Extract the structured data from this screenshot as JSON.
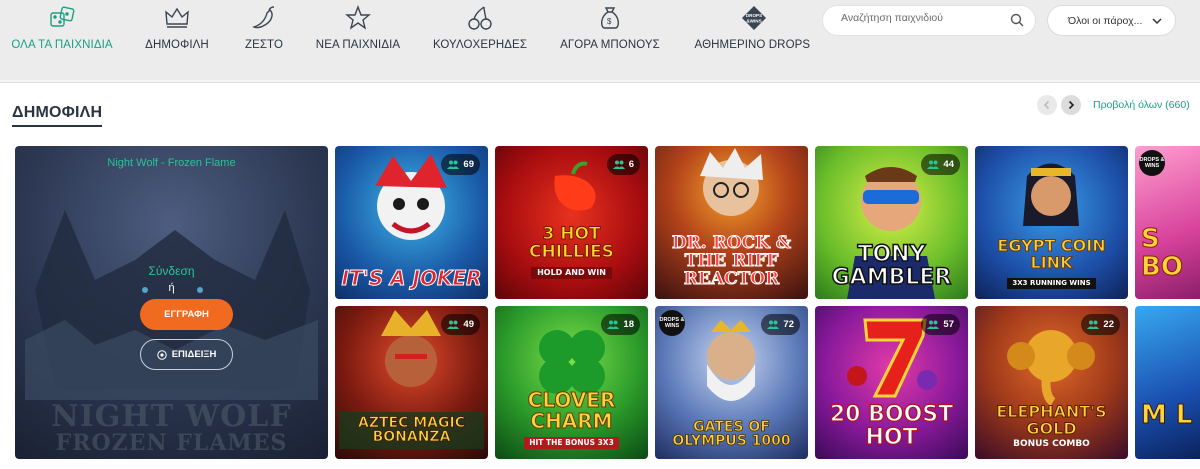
{
  "nav": {
    "items": [
      {
        "label": "ΟΛΑ ΤΑ ΠΑΙΧΝΙΔΙΑ",
        "icon": "dice-icon",
        "active": true
      },
      {
        "label": "ΔΗΜΟΦΙΛΗ",
        "icon": "crown-icon"
      },
      {
        "label": "ΖΕΣΤΟ",
        "icon": "chili-icon"
      },
      {
        "label": "ΝΕΑ ΠΑΙΧΝΙΔΙΑ",
        "icon": "star-icon"
      },
      {
        "label": "ΚΟΥΛΟΧΕΡΗΔΕΣ",
        "icon": "cherries-icon"
      },
      {
        "label": "ΑΓΟΡΑ ΜΠΟΝΟΥΣ",
        "icon": "money-bag-icon"
      },
      {
        "label": "ΚΑΘΗΜΕΡΙΝΟ DROPS &",
        "icon": "drops-wins-icon"
      }
    ],
    "drops_icon_text": "DROPS & WINS"
  },
  "search": {
    "placeholder": "Αναζήτηση παιχνιδιού"
  },
  "provider": {
    "selected": "Όλοι οι πάροχ..."
  },
  "section": {
    "title": "ΔΗΜΟΦΙΛΗ",
    "view_all": "Προβολή όλων (660)"
  },
  "featured": {
    "title": "Night Wolf - Frozen Flame",
    "login": "Σύνδεση",
    "or": "ή",
    "register": "ΕΓΓΡΑΦΗ",
    "demo": "ΕΠΙΔΕΙΞΗ",
    "logo_line1": "NIGHT WOLF",
    "logo_line2": "FROZEN FLAMES"
  },
  "games_row1": [
    {
      "title": "IT'S A JOKER",
      "players": "69"
    },
    {
      "title": "3 HOT CHILLIES",
      "subtitle": "HOLD AND WIN",
      "players": "6"
    },
    {
      "title": "DR. ROCK & THE RIFF REACTOR"
    },
    {
      "title": "TONY GAMBLER",
      "players": "44"
    },
    {
      "title": "EGYPT COIN LINK",
      "subtitle": "3X3 RUNNING WINS"
    },
    {
      "title": "S BO"
    }
  ],
  "games_row2": [
    {
      "title": "AZTEC MAGIC BONANZA",
      "players": "49"
    },
    {
      "title": "CLOVER CHARM",
      "subtitle": "HIT THE BONUS 3X3",
      "players": "18"
    },
    {
      "title": "GATES OF OLYMPUS 1000",
      "players": "72"
    },
    {
      "title": "20 BOOST HOT",
      "players": "57"
    },
    {
      "title": "ELEPHANT'S GOLD",
      "subtitle": "BONUS COMBO",
      "players": "22"
    },
    {
      "title": "M L"
    }
  ],
  "colors": {
    "accent": "#1a9f81",
    "register": "#f06a1f",
    "text": "#2a3542"
  }
}
